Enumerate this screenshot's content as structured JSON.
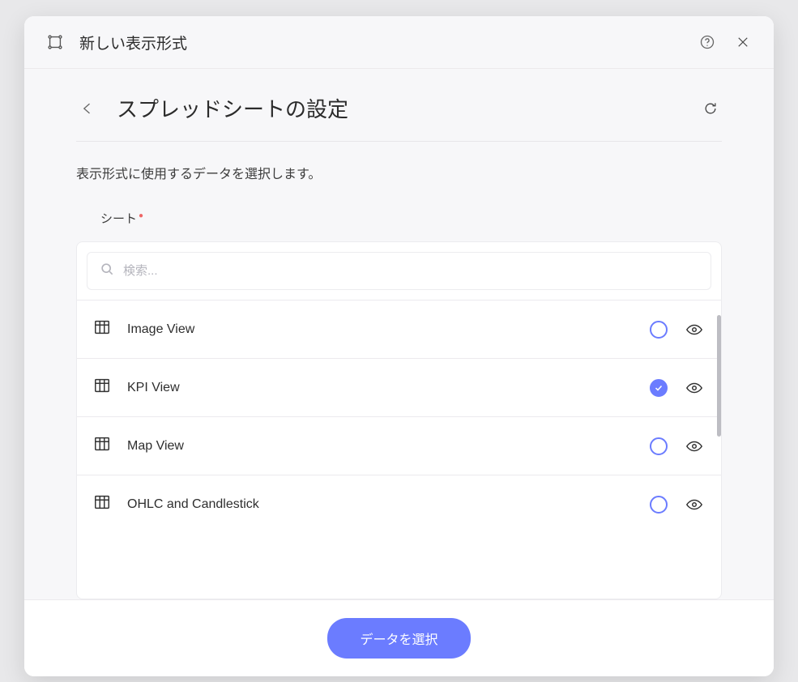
{
  "header": {
    "title": "新しい表示形式"
  },
  "subheader": {
    "title": "スプレッドシートの設定"
  },
  "description": "表示形式に使用するデータを選択します。",
  "section_label": "シート",
  "search": {
    "placeholder": "検索..."
  },
  "sheets": [
    {
      "label": "Image View",
      "selected": false
    },
    {
      "label": "KPI View",
      "selected": true
    },
    {
      "label": "Map View",
      "selected": false
    },
    {
      "label": "OHLC and Candlestick",
      "selected": false
    }
  ],
  "footer": {
    "primary_label": "データを選択"
  }
}
